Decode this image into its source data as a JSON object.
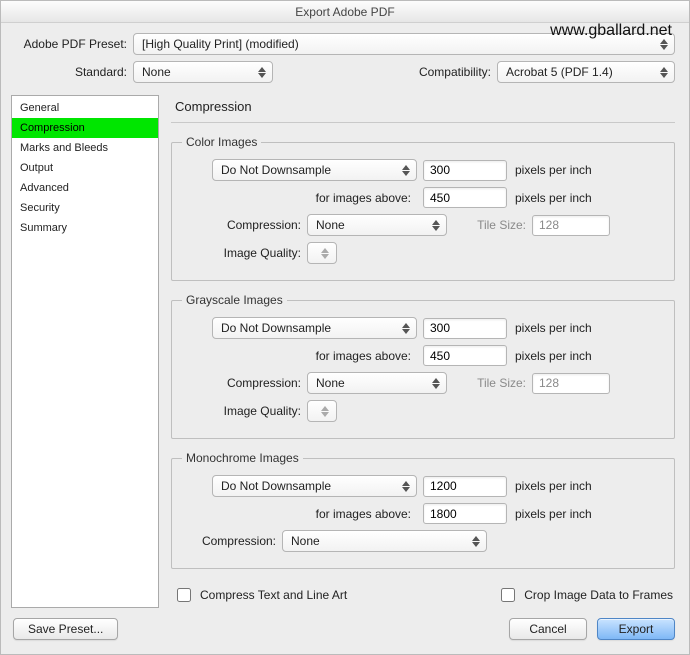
{
  "window_title": "Export Adobe PDF",
  "watermark": "www.gballard.net",
  "labels": {
    "preset": "Adobe PDF Preset:",
    "standard": "Standard:",
    "compat": "Compatibility:"
  },
  "preset_value": "[High Quality Print] (modified)",
  "standard_value": "None",
  "compat_value": "Acrobat 5 (PDF 1.4)",
  "sidebar": {
    "items": [
      {
        "label": "General"
      },
      {
        "label": "Compression"
      },
      {
        "label": "Marks and Bleeds"
      },
      {
        "label": "Output"
      },
      {
        "label": "Advanced"
      },
      {
        "label": "Security"
      },
      {
        "label": "Summary"
      }
    ],
    "selected_index": 1
  },
  "panel_title": "Compression",
  "groups": {
    "color": {
      "legend": "Color Images",
      "downsample": "Do Not Downsample",
      "dpi": "300",
      "above_label": "for images above:",
      "above_dpi": "450",
      "ppi": "pixels per inch",
      "compression_label": "Compression:",
      "compression": "None",
      "tile_label": "Tile Size:",
      "tile": "128",
      "iq_label": "Image Quality:"
    },
    "gray": {
      "legend": "Grayscale Images",
      "downsample": "Do Not Downsample",
      "dpi": "300",
      "above_label": "for images above:",
      "above_dpi": "450",
      "ppi": "pixels per inch",
      "compression_label": "Compression:",
      "compression": "None",
      "tile_label": "Tile Size:",
      "tile": "128",
      "iq_label": "Image Quality:"
    },
    "mono": {
      "legend": "Monochrome Images",
      "downsample": "Do Not Downsample",
      "dpi": "1200",
      "above_label": "for images above:",
      "above_dpi": "1800",
      "ppi": "pixels per inch",
      "compression_label": "Compression:",
      "compression": "None"
    }
  },
  "checkboxes": {
    "compress_text": "Compress Text and Line Art",
    "crop_image": "Crop Image Data to Frames"
  },
  "footer": {
    "save_preset": "Save Preset...",
    "cancel": "Cancel",
    "export": "Export"
  }
}
